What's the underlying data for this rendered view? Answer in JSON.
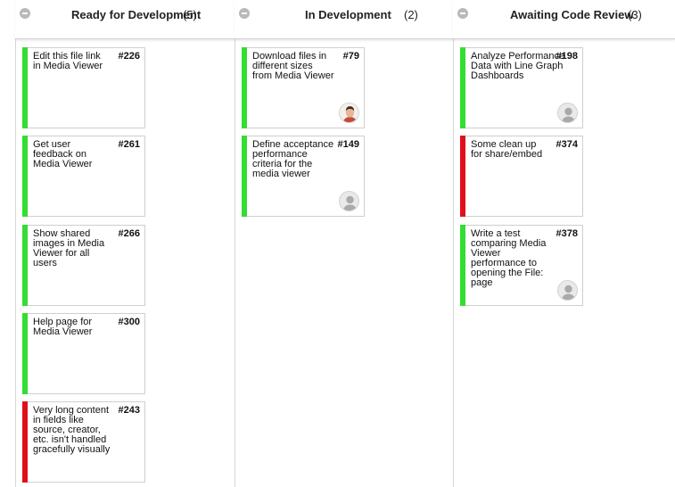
{
  "colors": {
    "green": "#33dd33",
    "red": "#e0101a",
    "divider": "#d6d6d6"
  },
  "columns": [
    {
      "title": "Ready for Development",
      "count": "(5)",
      "cards": [
        {
          "title": "Edit this file link in Media Viewer",
          "number": "#226",
          "status": "green",
          "avatar": "none"
        },
        {
          "title": "Get user feedback on Media Viewer",
          "number": "#261",
          "status": "green",
          "avatar": "none"
        },
        {
          "title": "Show shared images in Media Viewer for all users",
          "number": "#266",
          "status": "green",
          "avatar": "none"
        },
        {
          "title": "Help page for Media Viewer",
          "number": "#300",
          "status": "green",
          "avatar": "none"
        },
        {
          "title": "Very long content in fields like source, creator, etc. isn't handled gracefully visually",
          "number": "#243",
          "status": "red",
          "avatar": "none"
        }
      ]
    },
    {
      "title": "In Development",
      "count": "(2)",
      "cards": [
        {
          "title": "Download files in different sizes from Media Viewer",
          "number": "#79",
          "status": "green",
          "avatar": "person-photo"
        },
        {
          "title": "Define acceptance performance criteria for the media viewer",
          "number": "#149",
          "status": "green",
          "avatar": "default-silhouette"
        }
      ]
    },
    {
      "title": "Awaiting Code Review",
      "count": "(3)",
      "cards": [
        {
          "title": "Analyze Performance Data with Line Graph Dashboards",
          "number": "#198",
          "status": "green",
          "avatar": "default-silhouette"
        },
        {
          "title": "Some clean up for share/embed",
          "number": "#374",
          "status": "red",
          "avatar": "none"
        },
        {
          "title": "Write a test comparing Media Viewer performance to opening the File: page",
          "number": "#378",
          "status": "green",
          "avatar": "default-silhouette"
        }
      ]
    }
  ]
}
